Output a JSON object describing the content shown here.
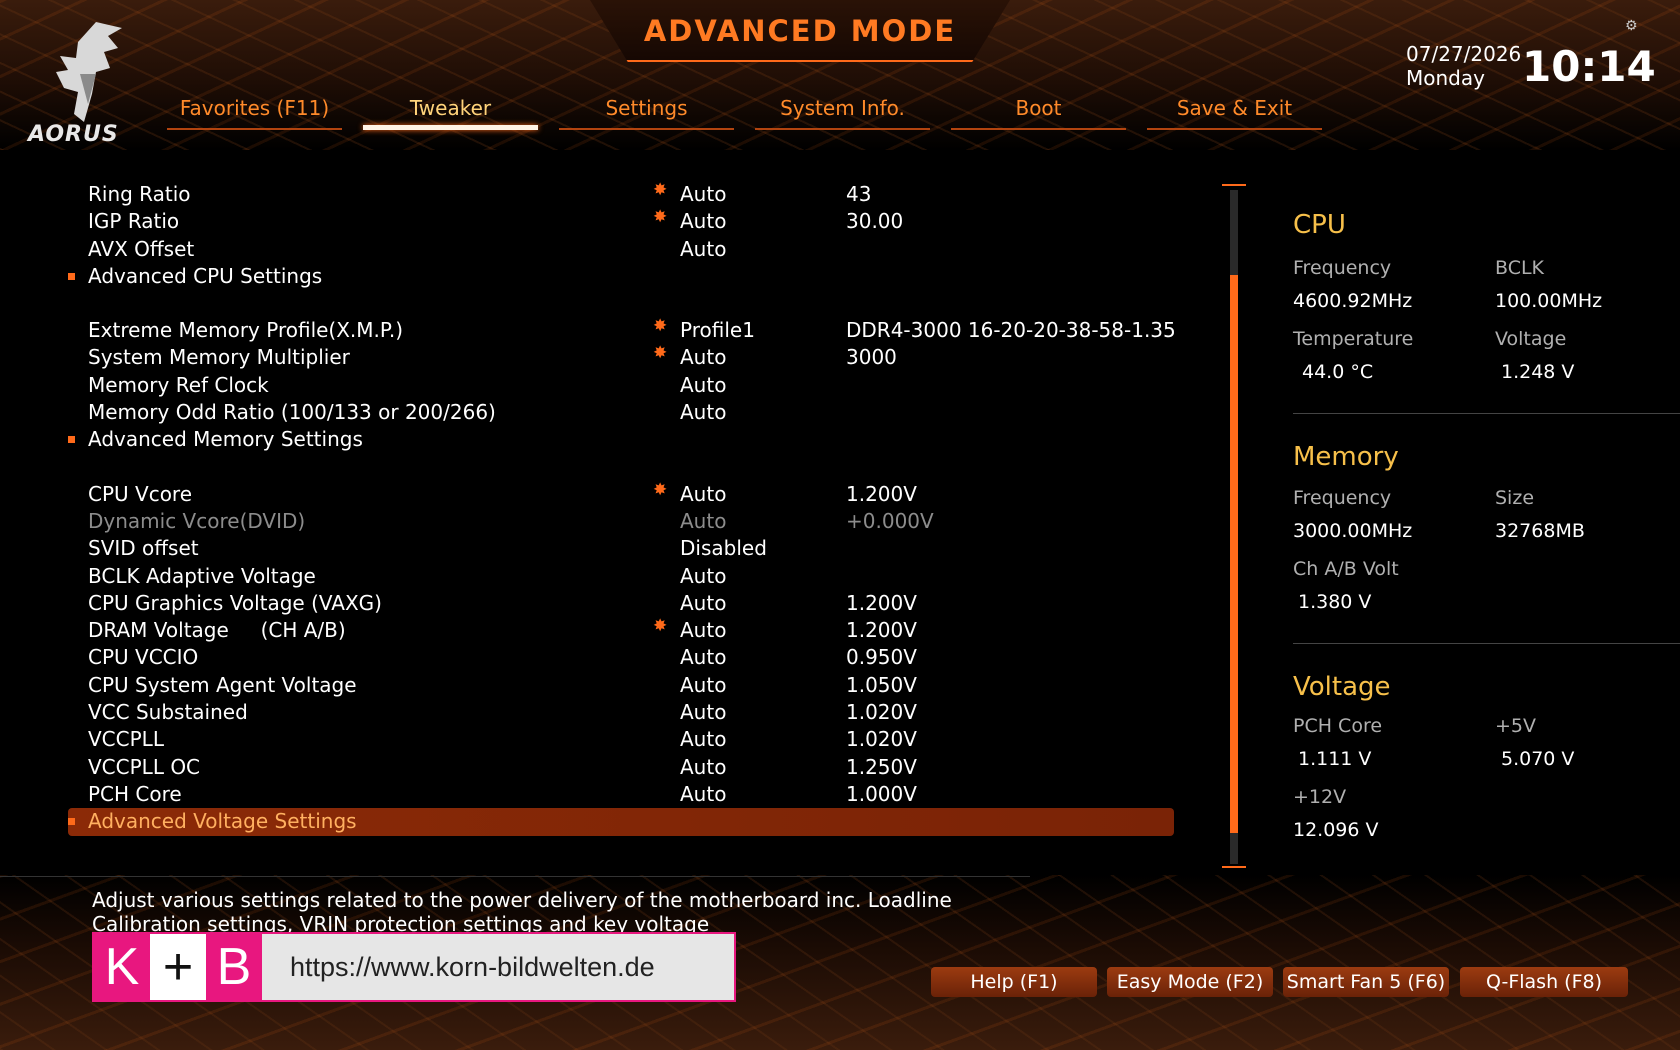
{
  "header": {
    "title": "ADVANCED MODE",
    "logo_text": "AORUS",
    "date": "07/27/2026",
    "weekday": "Monday",
    "time": "10:14",
    "settings_icon": "gear-icon"
  },
  "tabs": [
    {
      "label": "Favorites (F11)"
    },
    {
      "label": "Tweaker",
      "active": true
    },
    {
      "label": "Settings"
    },
    {
      "label": "System Info."
    },
    {
      "label": "Boot"
    },
    {
      "label": "Save & Exit"
    }
  ],
  "settings": [
    {
      "label": "Ring Ratio",
      "star": true,
      "option": "Auto",
      "value": "43"
    },
    {
      "label": "IGP Ratio",
      "star": true,
      "option": "Auto",
      "value": "30.00"
    },
    {
      "label": "AVX Offset",
      "option": "Auto",
      "value": ""
    },
    {
      "label": "Advanced CPU Settings",
      "submenu": true
    },
    {
      "gap": true
    },
    {
      "label": "Extreme Memory Profile(X.M.P.)",
      "star": true,
      "option": "Profile1",
      "value": "DDR4-3000 16-20-20-38-58-1.35"
    },
    {
      "label": "System Memory Multiplier",
      "star": true,
      "option": "Auto",
      "value": "3000"
    },
    {
      "label": "Memory Ref Clock",
      "option": "Auto",
      "value": ""
    },
    {
      "label": "Memory Odd Ratio (100/133 or 200/266)",
      "option": "Auto",
      "value": ""
    },
    {
      "label": "Advanced Memory Settings",
      "submenu": true
    },
    {
      "gap": true
    },
    {
      "label": "CPU Vcore",
      "star": true,
      "option": "Auto",
      "value": "1.200V"
    },
    {
      "label": "Dynamic Vcore(DVID)",
      "dim": true,
      "option": "Auto",
      "value": "+0.000V"
    },
    {
      "label": "SVID offset",
      "option": "Disabled",
      "value": ""
    },
    {
      "label": "BCLK Adaptive Voltage",
      "option": "Auto",
      "value": ""
    },
    {
      "label": "CPU Graphics Voltage (VAXG)",
      "option": "Auto",
      "value": "1.200V"
    },
    {
      "label": "DRAM Voltage     (CH A/B)",
      "star": true,
      "option": "Auto",
      "value": "1.200V"
    },
    {
      "label": "CPU VCCIO",
      "option": "Auto",
      "value": "0.950V"
    },
    {
      "label": "CPU System Agent Voltage",
      "option": "Auto",
      "value": "1.050V"
    },
    {
      "label": "VCC Substained",
      "option": "Auto",
      "value": "1.020V"
    },
    {
      "label": "VCCPLL",
      "option": "Auto",
      "value": "1.020V"
    },
    {
      "label": "VCCPLL OC",
      "option": "Auto",
      "value": "1.250V"
    },
    {
      "label": "PCH Core",
      "option": "Auto",
      "value": "1.000V"
    },
    {
      "label": "Advanced Voltage Settings",
      "submenu": true,
      "selected": true
    }
  ],
  "panel": {
    "cpu": {
      "title": "CPU",
      "frequency_label": "Frequency",
      "frequency": "4600.92MHz",
      "bclk_label": "BCLK",
      "bclk": "100.00MHz",
      "temperature_label": "Temperature",
      "temperature": "44.0 °C",
      "voltage_label": "Voltage",
      "voltage": "1.248 V"
    },
    "memory": {
      "title": "Memory",
      "frequency_label": "Frequency",
      "frequency": "3000.00MHz",
      "size_label": "Size",
      "size": "32768MB",
      "chab_label": "Ch A/B Volt",
      "chab": "1.380 V"
    },
    "voltage": {
      "title": "Voltage",
      "pch_label": "PCH Core",
      "pch": "1.111 V",
      "p5v_label": "+5V",
      "p5v": "5.070 V",
      "p12v_label": "+12V",
      "p12v": "12.096 V"
    }
  },
  "description": "Adjust various settings related to the power delivery of the motherboard inc. Loadline Calibration settings, VRIN protection settings and key voltage",
  "watermark": {
    "k": "K",
    "plus": "+",
    "b": "B",
    "url": "https://www.korn-bildwelten.de"
  },
  "footer_buttons": [
    {
      "label": "Help (F1)"
    },
    {
      "label": "Easy Mode (F2)"
    },
    {
      "label": "Smart Fan 5 (F6)"
    },
    {
      "label": "Q-Flash (F8)"
    }
  ],
  "colors": {
    "accent": "#ff6a1a",
    "section_title": "#f7c04a",
    "selected_row": "#8b2a07"
  }
}
